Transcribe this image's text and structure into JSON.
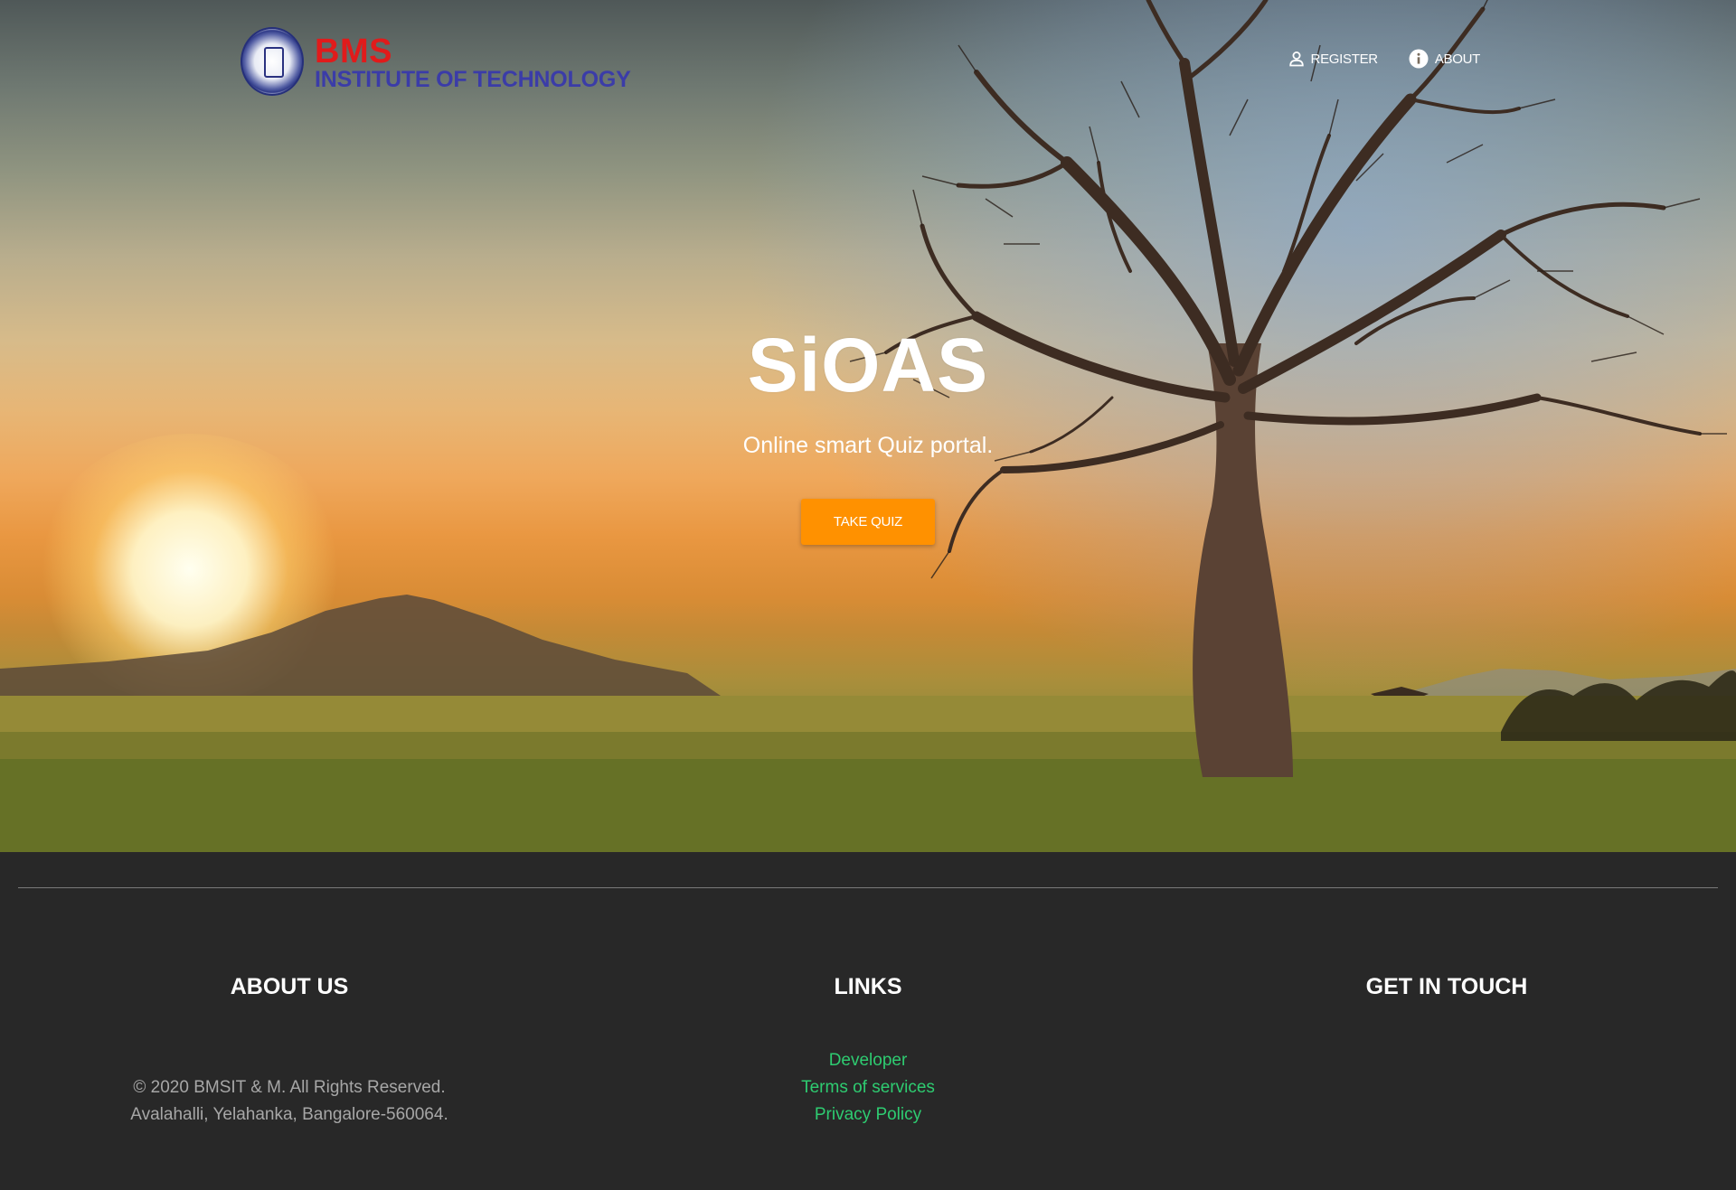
{
  "brand": {
    "name": "BMS",
    "subtitle": "INSTITUTE OF TECHNOLOGY",
    "colors": {
      "name": "#e01b1b",
      "subtitle": "#3b3ca8"
    }
  },
  "nav": {
    "items": [
      {
        "label": "REGISTER",
        "icon": "user-icon"
      },
      {
        "label": "ABOUT",
        "icon": "info-icon"
      }
    ]
  },
  "hero": {
    "title": "SiOAS",
    "subtitle": "Online smart Quiz portal.",
    "cta_label": "TAKE QUIZ",
    "cta_color": "#ff9100"
  },
  "footer": {
    "about": {
      "heading": "ABOUT US",
      "lines": [
        "© 2020 BMSIT & M. All Rights Reserved.",
        "Avalahalli, Yelahanka, Bangalore-560064."
      ]
    },
    "links": {
      "heading": "LINKS",
      "items": [
        "Developer",
        "Terms of services",
        "Privacy Policy"
      ],
      "color": "#2ecc71"
    },
    "contact": {
      "heading": "GET IN TOUCH"
    }
  }
}
